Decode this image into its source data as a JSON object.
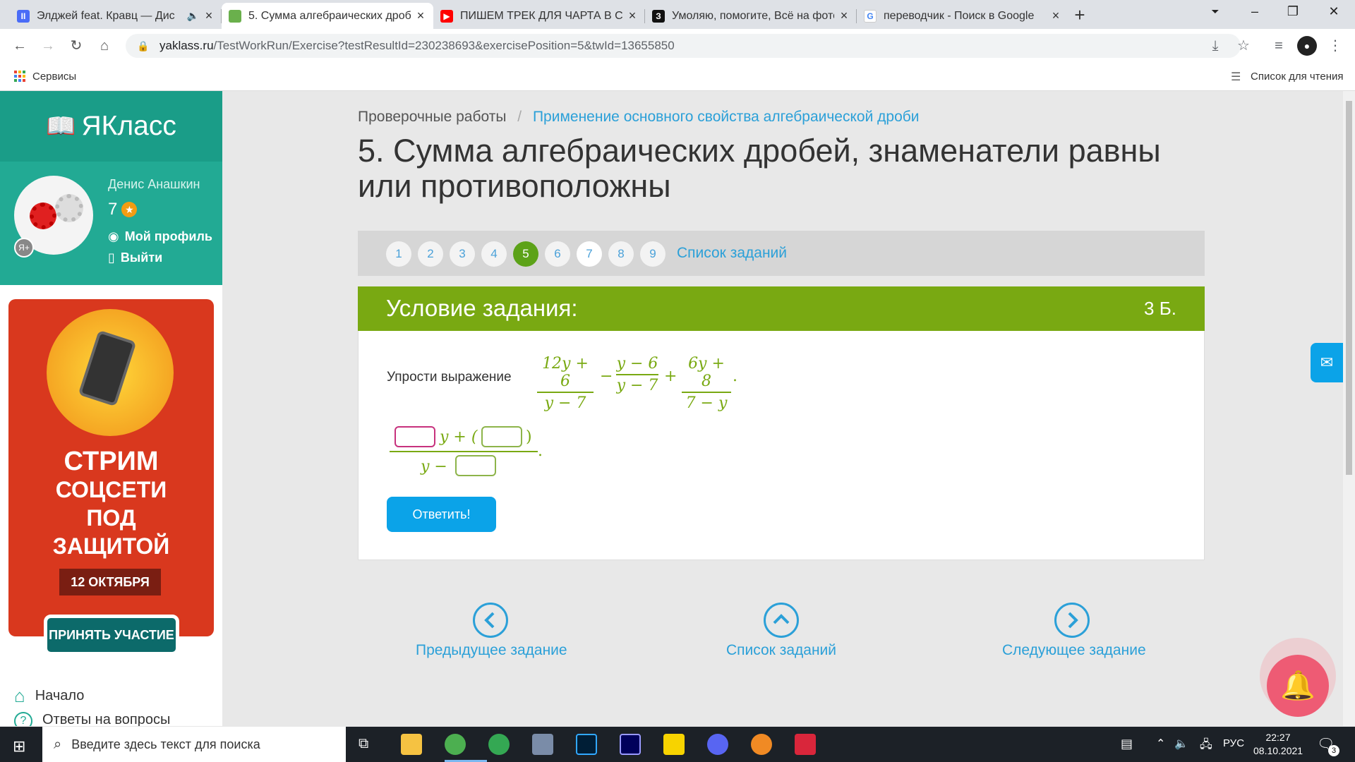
{
  "browser": {
    "tabs": [
      {
        "title": "Элджей feat. Кравц — Дис",
        "favicon_color": "#4a6cf7"
      },
      {
        "title": "5. Сумма алгебраических дробе",
        "favicon_color": "#6ab04c"
      },
      {
        "title": "ПИШЕМ ТРЕК ДЛЯ ЧАРТА В СТ",
        "favicon_color": "#ff0000"
      },
      {
        "title": "Умоляю, помогите, Всё на фото",
        "favicon_color": "#111111"
      },
      {
        "title": "переводчик - Поиск в Google",
        "favicon_color": "#4285f4"
      }
    ],
    "url_host": "yaklass.ru",
    "url_path": "/TestWorkRun/Exercise?testResultId=230238693&exercisePosition=5&twId=13655850",
    "bookmarks_apps_label": "Сервисы",
    "reading_list_label": "Список для чтения"
  },
  "sidebar": {
    "logo_text": "ЯКласс",
    "user_name": "Денис Анашкин",
    "points": "7",
    "profile_link": "Мой профиль",
    "logout_link": "Выйти",
    "promo": {
      "line1": "СТРИМ",
      "line2": "СОЦСЕТИ",
      "line3": "ПОД",
      "line4": "ЗАЩИТОЙ",
      "date": "12 ОКТЯБРЯ",
      "button": "ПРИНЯТЬ УЧАСТИЕ"
    },
    "nav": [
      {
        "label": "Начало"
      },
      {
        "label": "Ответы на вопросы"
      }
    ]
  },
  "main": {
    "breadcrumb_root": "Проверочные работы",
    "breadcrumb_separator": "/",
    "breadcrumb_current": "Применение основного свойства алгебраической дроби",
    "title": "5. Сумма алгебраических дробей, знаменатели равны или противоположны",
    "pages": [
      "1",
      "2",
      "3",
      "4",
      "5",
      "6",
      "7",
      "8",
      "9"
    ],
    "current_page": "5",
    "task_list_link": "Список заданий",
    "condition_title": "Условие задания:",
    "points_label": "3 Б.",
    "prompt": "Упрости выражение",
    "expr": {
      "f1_num": "12y + 6",
      "f1_den": "y − 7",
      "op1": "−",
      "f2_num": "y − 6",
      "f2_den": "y − 7",
      "op2": "+",
      "f3_num": "6y + 8",
      "f3_den": "7 − y",
      "end": "."
    },
    "answer": {
      "num_mid": "y + (",
      "num_close": ")",
      "den_prefix": "y −",
      "end": "."
    },
    "submit_label": "Ответить!",
    "prev_label": "Предыдущее задание",
    "list_label": "Список заданий",
    "next_label": "Следующее задание"
  },
  "taskbar": {
    "search_placeholder": "Введите здесь текст для поиска",
    "lang": "РУС",
    "time": "22:27",
    "date": "08.10.2021",
    "notif_count": "3"
  }
}
